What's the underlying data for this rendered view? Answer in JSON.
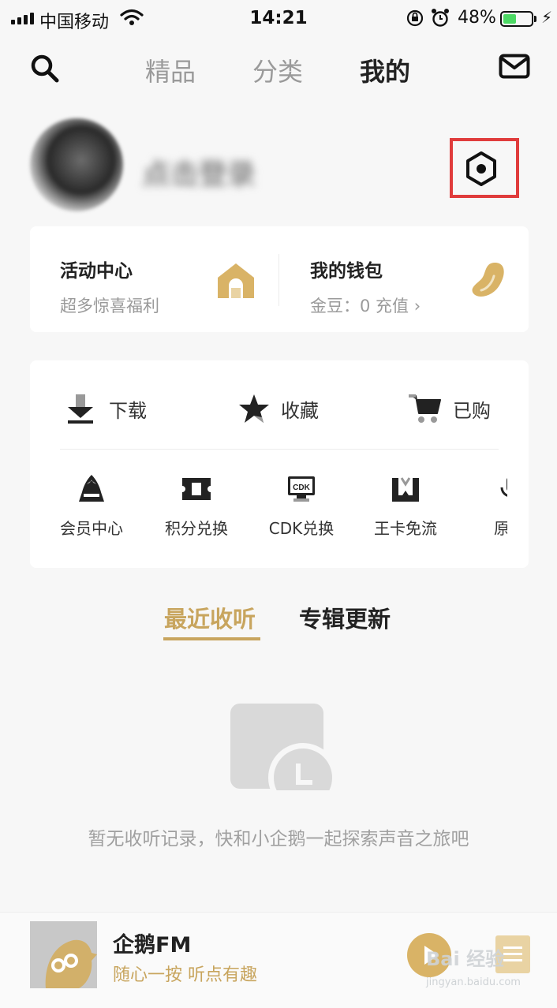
{
  "status_bar": {
    "carrier": "中国移动",
    "time": "14:21",
    "battery": "48%",
    "battery_level": 0.48
  },
  "nav": {
    "tabs": [
      {
        "label": "精品",
        "active": false
      },
      {
        "label": "分类",
        "active": false
      },
      {
        "label": "我的",
        "active": true
      }
    ],
    "icons": [
      "search-icon",
      "mail-icon"
    ]
  },
  "profile": {
    "login_text": "点击登录",
    "settings_icon": "hexagon-settings-icon"
  },
  "activity": {
    "title": "活动中心",
    "subtitle": "超多惊喜福利"
  },
  "wallet": {
    "title": "我的钱包",
    "subtitle": "金豆：0  充值 ›"
  },
  "quick_actions": [
    {
      "label": "下载",
      "icon": "download-icon"
    },
    {
      "label": "收藏",
      "icon": "star-icon"
    },
    {
      "label": "已购",
      "icon": "cart-icon"
    }
  ],
  "grid": [
    {
      "label": "会员中心",
      "icon": "crown-icon"
    },
    {
      "label": "积分兑换",
      "icon": "ticket-icon"
    },
    {
      "label": "CDK兑换",
      "icon": "cdk-icon"
    },
    {
      "label": "王卡免流",
      "icon": "king-card-icon"
    },
    {
      "label": "原创",
      "icon": "mic-icon"
    }
  ],
  "cdk_badge": "CDK",
  "section_tabs": [
    {
      "label": "最近收听",
      "active": true
    },
    {
      "label": "专辑更新",
      "active": false
    }
  ],
  "empty_state": {
    "text": "暂无收听记录，快和小企鹅一起探索声音之旅吧"
  },
  "player": {
    "title": "企鹅FM",
    "subtitle": "随心一按 听点有趣"
  },
  "watermark": {
    "text": "Bai 经验",
    "url": "jingyan.baidu.com"
  },
  "colors": {
    "accent": "#c8a55e",
    "gold_icon": "#d9b366",
    "highlight_box": "#e03c3c"
  }
}
